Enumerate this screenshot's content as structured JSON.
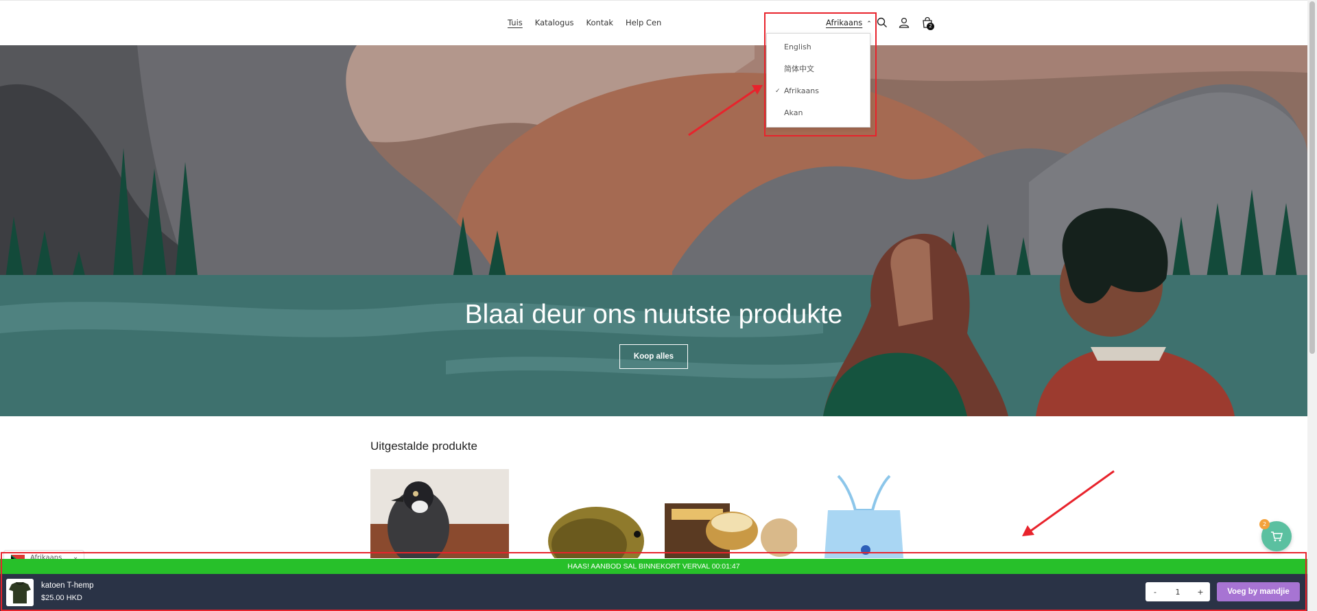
{
  "header": {
    "nav": [
      {
        "label": "Tuis",
        "active": true
      },
      {
        "label": "Katalogus",
        "active": false
      },
      {
        "label": "Kontak",
        "active": false
      },
      {
        "label": "Help Cen",
        "active": false
      }
    ],
    "language_selected": "Afrikaans",
    "cart_count": "2",
    "icons": [
      "search-icon",
      "account-icon",
      "cart-icon"
    ]
  },
  "language_menu": {
    "options": [
      {
        "label": "English",
        "selected": false
      },
      {
        "label": "简体中文",
        "selected": false
      },
      {
        "label": "Afrikaans",
        "selected": true
      },
      {
        "label": "Akan",
        "selected": false
      }
    ]
  },
  "hero": {
    "title": "Blaai deur ons nuutste produkte",
    "button_label": "Koop alles"
  },
  "featured": {
    "title": "Uitgestalde produkte",
    "cards": [
      "bird-plush",
      "hedgehog-toy",
      "bee-venom-cream",
      "blue-halter-top"
    ]
  },
  "language_pill": {
    "label": "Afrikaans"
  },
  "promo_bar": {
    "text": "HAAS! AANBOD SAL BINNEKORT VERVAL 00:01:47"
  },
  "sticky_cart": {
    "product_name": "katoen T-hemp",
    "price": "$25.00 HKD",
    "minus": "-",
    "quantity": "1",
    "plus": "+",
    "add_label": "Voeg by mandjie"
  },
  "chat": {
    "badge": "2"
  },
  "colors": {
    "promo": "#27c02a",
    "sticky_bg": "#2a3346",
    "add_button": "#a774d3",
    "annotation": "#e8232c",
    "chat": "#5bc0a0"
  }
}
